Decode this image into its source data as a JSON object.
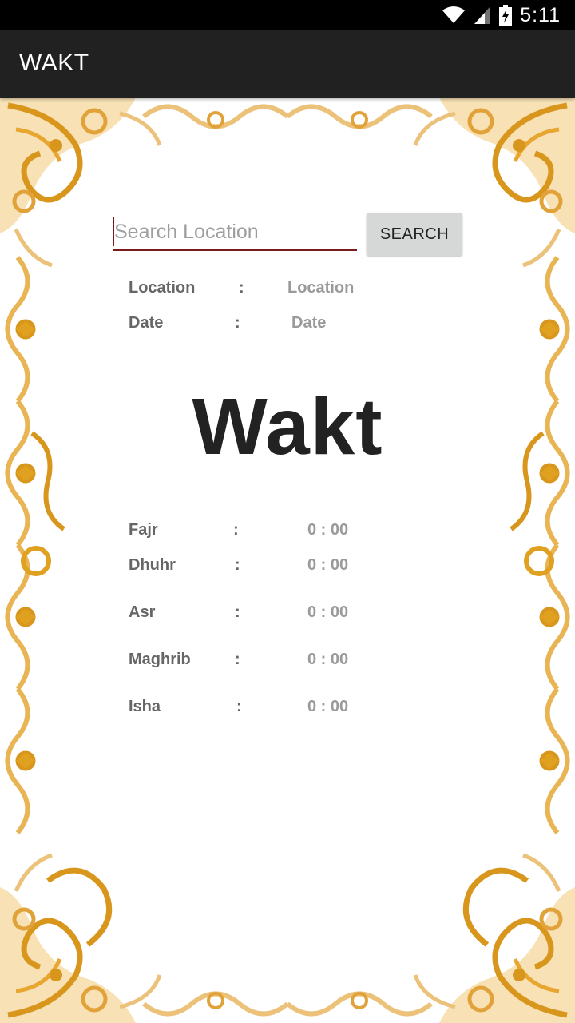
{
  "status_bar": {
    "time": "5:11",
    "icons": [
      "wifi-icon",
      "signal-icon",
      "battery-charging-icon"
    ]
  },
  "app_bar": {
    "title": "WAKT"
  },
  "search": {
    "placeholder": "Search Location",
    "value": "",
    "button_label": "SEARCH"
  },
  "info": {
    "location_label": "Location",
    "location_value": "Location",
    "date_label": "Date",
    "date_value": "Date",
    "separator": ":"
  },
  "brand_title": "Wakt",
  "prayers": [
    {
      "name": "Fajr",
      "time": "0 : 00"
    },
    {
      "name": "Dhuhr",
      "time": "0 : 00"
    },
    {
      "name": "Asr",
      "time": "0 : 00"
    },
    {
      "name": "Maghrib",
      "time": "0 : 00"
    },
    {
      "name": "Isha",
      "time": "0 : 00"
    }
  ],
  "colors": {
    "status_bar": "#000000",
    "app_bar": "#212121",
    "accent": "#7a1b1b",
    "ornament": "#e0a020"
  }
}
